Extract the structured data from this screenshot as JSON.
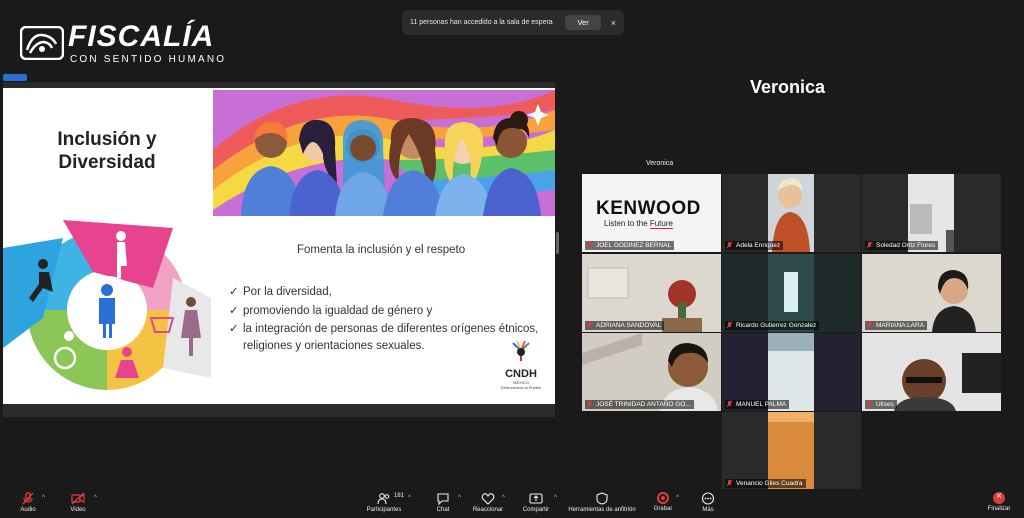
{
  "logo": {
    "title": "FISCALÍA",
    "subtitle": "CON SENTIDO HUMANO"
  },
  "waiting_room": {
    "message": "11 personas han accedido a la sala de espera",
    "view_label": "Ver",
    "close_glyph": "×"
  },
  "shared_screen": {
    "slide": {
      "title_line1": "Inclusión y",
      "title_line2": "Diversidad",
      "heading": "Fomenta la inclusión y el respeto",
      "bullets": [
        "Por la diversidad,",
        "promoviendo la igualdad de género y",
        "la integración de personas de diferentes orígenes étnicos, religiones y orientaciones sexuales."
      ],
      "cndh_name": "CNDH",
      "cndh_country": "MÉXICO",
      "cndh_motto": "Defendemos al Pueblo"
    }
  },
  "active_speaker": {
    "name": "Veronica",
    "tag": "Veronica"
  },
  "gallery": {
    "kenwood_logo": "KENWOOD",
    "kenwood_tag_pre": "Listen to the ",
    "kenwood_tag_u": "Future",
    "participants": [
      "JOEL GODINEZ BERNAL",
      "Adela Enriquez",
      "Soledad Ortiz Flores",
      "ADRIANA SANDOVAL",
      "Ricardo Gutierrez Gonzalez",
      "MARIANA LARA",
      "JOSÉ TRINIDAD ANTAÑO GO...",
      "MANUEL PALMA",
      "Ulises",
      "Venancio Giles Cuadra"
    ]
  },
  "toolbar": {
    "audio": "Audio",
    "video": "Video",
    "participants": "Participantes",
    "participants_count": "181",
    "chat": "Chat",
    "react": "Reaccionar",
    "share": "Compartir",
    "host_tools": "Herramientas de anfitrión",
    "record": "Grabar",
    "more": "Más",
    "end": "Finalizar"
  },
  "colors": {
    "accent": "#2a6fd6",
    "muted_red": "#e03c3c",
    "bg": "#1a1a1a"
  }
}
